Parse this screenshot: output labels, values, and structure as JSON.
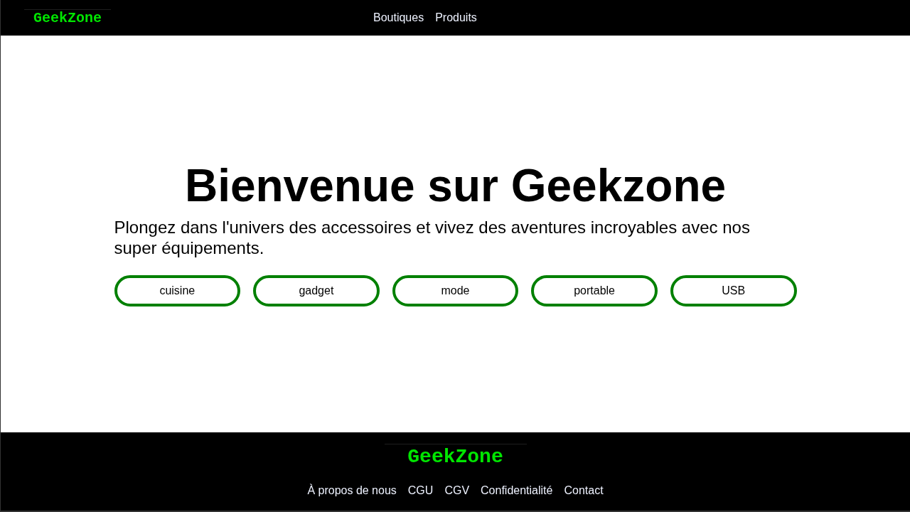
{
  "header": {
    "logo": "GeekZone",
    "nav": [
      "Boutiques",
      "Produits"
    ]
  },
  "hero": {
    "title": "Bienvenue sur Geekzone",
    "subtitle": "Plongez dans l'univers des accessoires et vivez des aventures incroyables avec nos super équipements.",
    "tags": [
      "cuisine",
      "gadget",
      "mode",
      "portable",
      "USB"
    ]
  },
  "footer": {
    "logo": "GeekZone",
    "links": [
      "À propos de nous",
      "CGU",
      "CGV",
      "Confidentialité",
      "Contact"
    ]
  }
}
